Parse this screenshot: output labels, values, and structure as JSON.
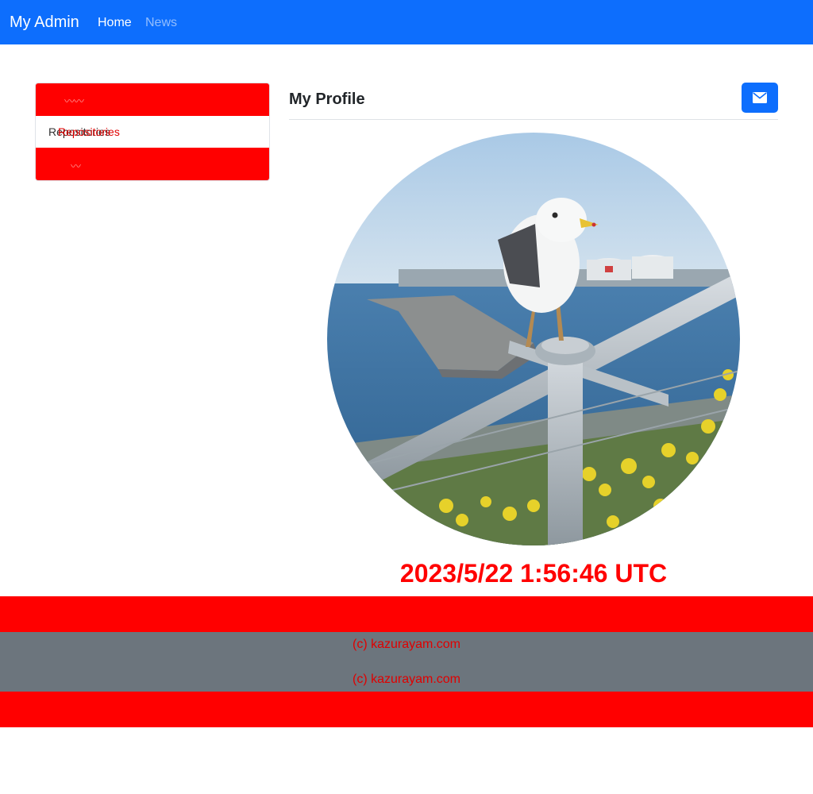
{
  "navbar": {
    "brand": "My Admin",
    "links": [
      {
        "label": "Home"
      },
      {
        "label": "News"
      }
    ],
    "color": "#0d6efd"
  },
  "sidebar": {
    "items": [
      {
        "label": "Repositories"
      },
      {
        "label": "Repositories"
      }
    ]
  },
  "main": {
    "title": "My Profile",
    "mail_icon": "envelope-icon",
    "timestamp": "2023/5/22 1:56:46 UTC",
    "photo": "seagull-on-railing"
  },
  "footer": {
    "copyright_1": "(c) kazurayam.com",
    "copyright_2": "(c) kazurayam.com"
  },
  "colors": {
    "accent": "#0d6efd",
    "highlight": "#ff0000",
    "footer_bg": "#6c757d"
  }
}
